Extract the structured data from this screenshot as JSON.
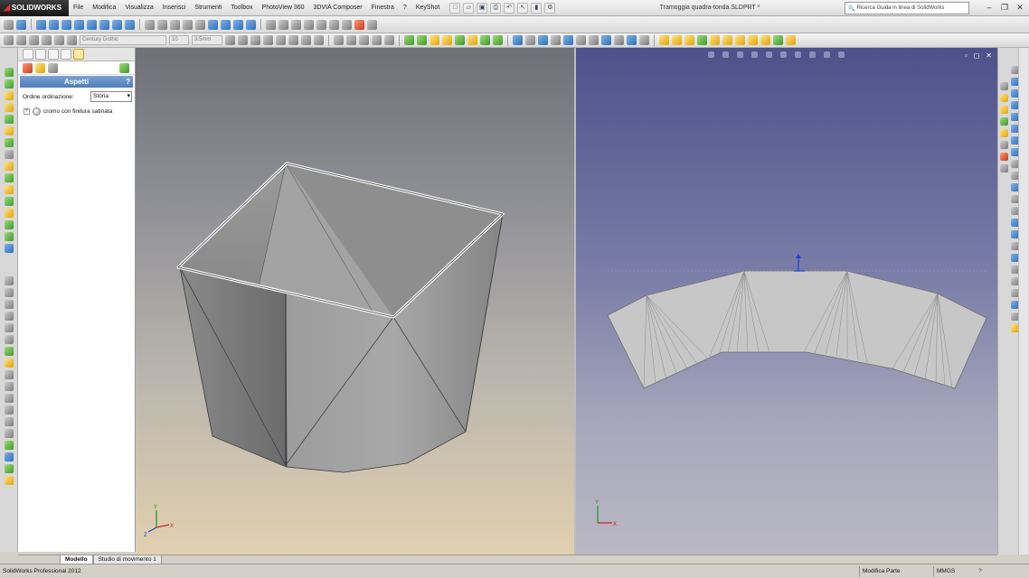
{
  "app": {
    "logo": "SOLIDWORKS",
    "document_title": "Tramoggia quadra-tonda.SLDPRT *",
    "search_placeholder": "Ricerca Guida in linea di SolidWorks"
  },
  "menu": [
    "File",
    "Modifica",
    "Visualizza",
    "Inserisci",
    "Strumenti",
    "Toolbox",
    "PhotoView 360",
    "3DVIA Composer",
    "Finestra",
    "?",
    "KeyShot"
  ],
  "format_toolbar": {
    "font": "Century Gothic",
    "size": "10",
    "height": "3.5mm"
  },
  "panel": {
    "header": "Aspetti",
    "help": "?",
    "sort_label": "Ordine ordinazione:",
    "sort_value": "Storia",
    "tree_items": [
      {
        "expander": "+",
        "label": "cromo con finitura satinata"
      }
    ]
  },
  "bottom_tabs": [
    "Modello",
    "Studio di movimento 1"
  ],
  "status": {
    "product": "SolidWorks Professional 2012",
    "mode": "Modifica Parte",
    "units": "MMGS",
    "help": "?"
  },
  "colors": {
    "left_viewport_top": "#6f6f77",
    "left_viewport_bottom": "#e2d0b0",
    "right_viewport_top": "#4c518a",
    "right_viewport_bottom": "#bab8c4",
    "panel_header": "#5a86c0",
    "triad_x": "#d02020",
    "triad_y": "#1a9a1a",
    "triad_z": "#2040d0"
  },
  "icons": {
    "quick_access": [
      "new-icon",
      "open-icon",
      "save-icon",
      "print-icon",
      "undo-icon",
      "select-icon",
      "rebuild-icon",
      "options-icon"
    ],
    "panel_tabs": [
      "feature-manager-icon",
      "property-manager-icon",
      "configuration-manager-icon",
      "dimxpert-icon",
      "display-manager-icon"
    ],
    "window_controls": [
      "minimize-icon",
      "restore-icon",
      "close-icon"
    ]
  }
}
